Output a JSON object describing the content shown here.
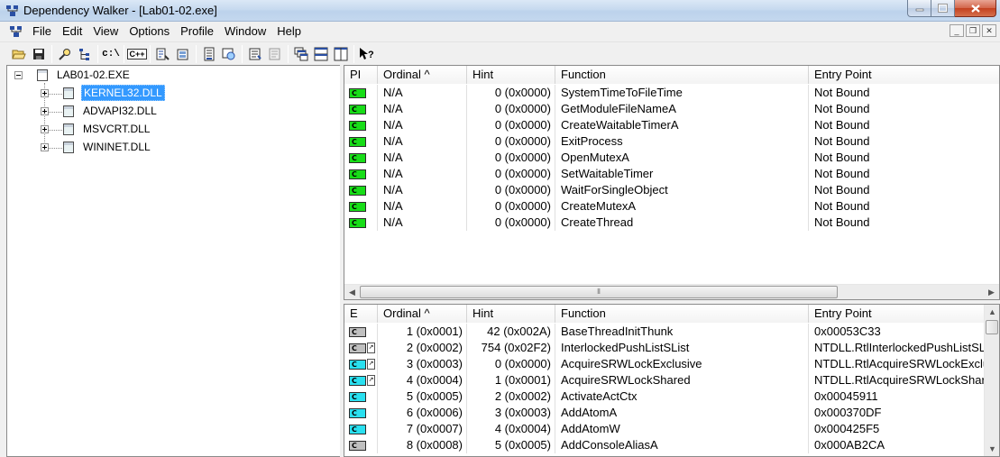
{
  "window": {
    "title": "Dependency Walker - [Lab01-02.exe]"
  },
  "menu": [
    "File",
    "Edit",
    "View",
    "Options",
    "Profile",
    "Window",
    "Help"
  ],
  "toolbar": {
    "buttons": [
      "open-icon",
      "save-icon",
      "find-icon",
      "copy-icon",
      "full-paths-icon",
      "undecorate-icon",
      "cpp-icon",
      "auto-expand-icon",
      "expand-all-icon",
      "collapse-all-icon",
      "view-module-icon",
      "external-viewer-icon",
      "properties-icon",
      "cascade-icon",
      "tile-horizontal-icon",
      "tile-vertical-icon",
      "help-icon"
    ],
    "cpath_label": "c:\\",
    "cpp_label": "C++"
  },
  "tree": {
    "root": "LAB01-02.EXE",
    "children": [
      "KERNEL32.DLL",
      "ADVAPI32.DLL",
      "MSVCRT.DLL",
      "WININET.DLL"
    ],
    "selected": "KERNEL32.DLL"
  },
  "imports": {
    "columns": {
      "pi": "PI",
      "ordinal": "Ordinal ^",
      "hint": "Hint",
      "function": "Function",
      "entry": "Entry Point"
    },
    "rows": [
      {
        "ordinal": "N/A",
        "hint": "0 (0x0000)",
        "function": "SystemTimeToFileTime",
        "entry": "Not Bound"
      },
      {
        "ordinal": "N/A",
        "hint": "0 (0x0000)",
        "function": "GetModuleFileNameA",
        "entry": "Not Bound"
      },
      {
        "ordinal": "N/A",
        "hint": "0 (0x0000)",
        "function": "CreateWaitableTimerA",
        "entry": "Not Bound"
      },
      {
        "ordinal": "N/A",
        "hint": "0 (0x0000)",
        "function": "ExitProcess",
        "entry": "Not Bound"
      },
      {
        "ordinal": "N/A",
        "hint": "0 (0x0000)",
        "function": "OpenMutexA",
        "entry": "Not Bound"
      },
      {
        "ordinal": "N/A",
        "hint": "0 (0x0000)",
        "function": "SetWaitableTimer",
        "entry": "Not Bound"
      },
      {
        "ordinal": "N/A",
        "hint": "0 (0x0000)",
        "function": "WaitForSingleObject",
        "entry": "Not Bound"
      },
      {
        "ordinal": "N/A",
        "hint": "0 (0x0000)",
        "function": "CreateMutexA",
        "entry": "Not Bound"
      },
      {
        "ordinal": "N/A",
        "hint": "0 (0x0000)",
        "function": "CreateThread",
        "entry": "Not Bound"
      }
    ],
    "icon_color": "#18dd18"
  },
  "exports": {
    "columns": {
      "e": "E",
      "ordinal": "Ordinal ^",
      "hint": "Hint",
      "function": "Function",
      "entry": "Entry Point"
    },
    "rows": [
      {
        "icon": "gray",
        "fwd": false,
        "ordinal": "1 (0x0001)",
        "hint": "42 (0x002A)",
        "function": "BaseThreadInitThunk",
        "entry": "0x00053C33"
      },
      {
        "icon": "gray",
        "fwd": true,
        "ordinal": "2 (0x0002)",
        "hint": "754 (0x02F2)",
        "function": "InterlockedPushListSList",
        "entry": "NTDLL.RtlInterlockedPushListSList"
      },
      {
        "icon": "cyan",
        "fwd": true,
        "ordinal": "3 (0x0003)",
        "hint": "0 (0x0000)",
        "function": "AcquireSRWLockExclusive",
        "entry": "NTDLL.RtlAcquireSRWLockExclusive"
      },
      {
        "icon": "cyan",
        "fwd": true,
        "ordinal": "4 (0x0004)",
        "hint": "1 (0x0001)",
        "function": "AcquireSRWLockShared",
        "entry": "NTDLL.RtlAcquireSRWLockShared"
      },
      {
        "icon": "cyan",
        "fwd": false,
        "ordinal": "5 (0x0005)",
        "hint": "2 (0x0002)",
        "function": "ActivateActCtx",
        "entry": "0x00045911"
      },
      {
        "icon": "cyan",
        "fwd": false,
        "ordinal": "6 (0x0006)",
        "hint": "3 (0x0003)",
        "function": "AddAtomA",
        "entry": "0x000370DF"
      },
      {
        "icon": "cyan",
        "fwd": false,
        "ordinal": "7 (0x0007)",
        "hint": "4 (0x0004)",
        "function": "AddAtomW",
        "entry": "0x000425F5"
      },
      {
        "icon": "gray",
        "fwd": false,
        "ordinal": "8 (0x0008)",
        "hint": "5 (0x0005)",
        "function": "AddConsoleAliasA",
        "entry": "0x000AB2CA"
      }
    ]
  },
  "icon_glyph": "C",
  "fwd_glyph": "↗"
}
